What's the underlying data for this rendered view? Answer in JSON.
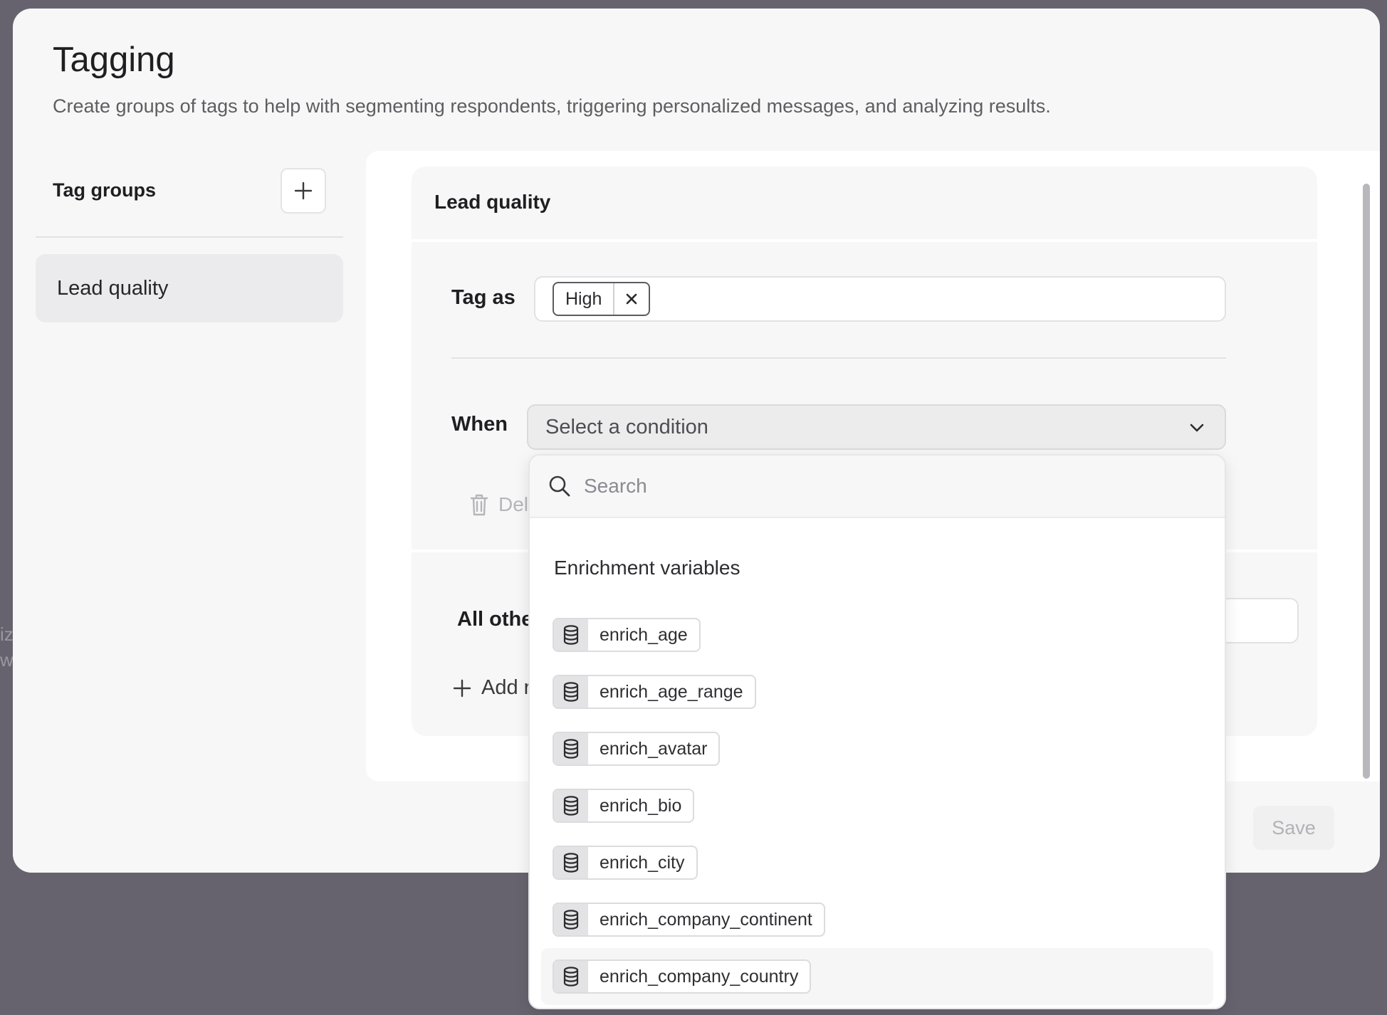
{
  "modal": {
    "title": "Tagging",
    "subtitle": "Create groups of tags to help with segmenting respondents, triggering personalized messages, and analyzing results.",
    "save_label": "Save"
  },
  "tag_groups": {
    "header": "Tag groups",
    "items": [
      {
        "label": "Lead quality",
        "selected": true
      }
    ]
  },
  "card": {
    "title": "Lead quality",
    "tag_as_label": "Tag as",
    "tag_chip": "High",
    "when_label": "When",
    "condition_placeholder": "Select a condition",
    "delete_label": "Del",
    "all_others_label": "All othe",
    "add_label": "Add r"
  },
  "background_hints": [
    "iz",
    "w"
  ],
  "dropdown": {
    "search_placeholder": "Search",
    "section_title": "Enrichment variables",
    "items": [
      "enrich_age",
      "enrich_age_range",
      "enrich_avatar",
      "enrich_bio",
      "enrich_city",
      "enrich_company_continent",
      "enrich_company_country"
    ],
    "highlighted_index": 6
  },
  "icons": {
    "add": "plus-icon",
    "remove": "close-icon",
    "chevron": "chevron-down-icon",
    "delete": "trash-icon",
    "search": "search-icon",
    "variable": "database-icon"
  }
}
